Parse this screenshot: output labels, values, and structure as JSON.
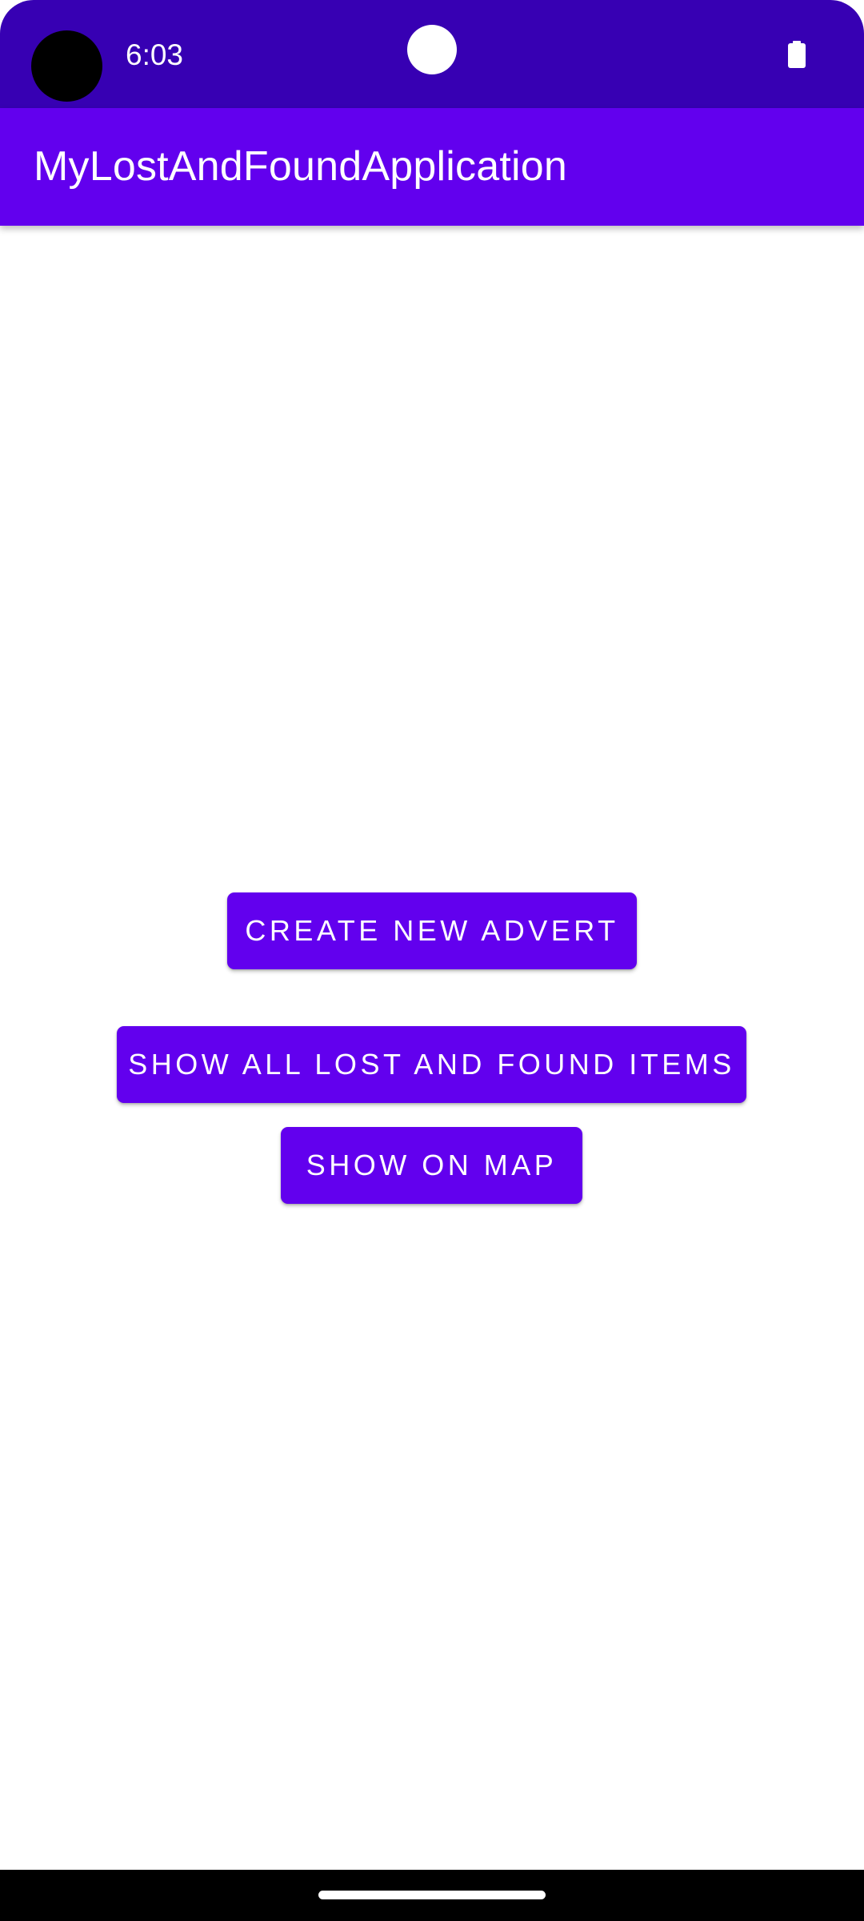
{
  "status_bar": {
    "time": "6:03",
    "background_color": "#3700B3",
    "icons": [
      "camera-cutout",
      "notification-dot-icon",
      "battery-icon"
    ]
  },
  "app_bar": {
    "title": "MyLostAndFoundApplication",
    "background_color": "#6200EE"
  },
  "main": {
    "buttons": [
      {
        "id": "create",
        "label": "CREATE NEW ADVERT"
      },
      {
        "id": "show_all",
        "label": "SHOW ALL LOST AND FOUND ITEMS"
      },
      {
        "id": "map",
        "label": "SHOW ON MAP"
      }
    ],
    "button_color": "#6200EE"
  },
  "nav_bar": {
    "icons": [
      "home-handle"
    ]
  }
}
